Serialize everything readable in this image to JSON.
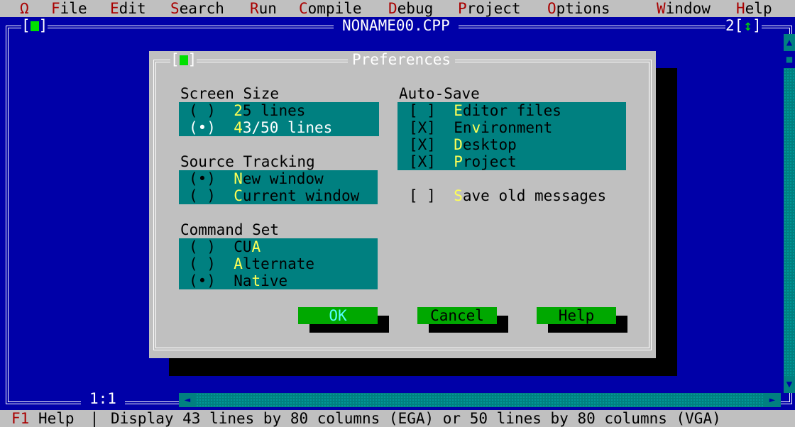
{
  "menu": {
    "system": "Ω",
    "items": [
      {
        "hk": "F",
        "rest": "ile"
      },
      {
        "hk": "E",
        "rest": "dit"
      },
      {
        "hk": "S",
        "rest": "earch"
      },
      {
        "hk": "R",
        "rest": "un"
      },
      {
        "hk": "C",
        "rest": "ompile"
      },
      {
        "hk": "D",
        "rest": "ebug"
      },
      {
        "hk": "P",
        "rest": "roject"
      },
      {
        "hk": "O",
        "rest": "ptions"
      },
      {
        "hk": "W",
        "rest": "indow"
      },
      {
        "hk": "H",
        "rest": "elp"
      }
    ]
  },
  "editor": {
    "title": "NONAME00.CPP",
    "window_number": "2",
    "close_left": "[",
    "close_right": "]",
    "zoom_left": "[",
    "zoom_glyph": "↕",
    "zoom_right": "]",
    "cursor_position": "1:1"
  },
  "dialog": {
    "title": "Preferences",
    "close_left": "[",
    "close_right": "]",
    "screen_size": {
      "label": "Screen Size",
      "options": [
        {
          "pre": "( )  ",
          "hk": "2",
          "post": "5 lines",
          "selected": false
        },
        {
          "pre": "(•)  ",
          "hk": "4",
          "post": "3/50 lines",
          "selected": true
        }
      ]
    },
    "source_tracking": {
      "label": "Source Tracking",
      "options": [
        {
          "pre": "(•)  ",
          "hk": "N",
          "post": "ew window",
          "selected": true
        },
        {
          "pre": "( )  ",
          "hk": "C",
          "post": "urrent window",
          "selected": false
        }
      ]
    },
    "command_set": {
      "label": "Command Set",
      "options": [
        {
          "pre": "( )  ",
          "hk_pre": "CU",
          "hk": "A",
          "post": "",
          "selected": false
        },
        {
          "pre": "( )  ",
          "hk_pre": "",
          "hk": "A",
          "post": "lternate",
          "selected": false
        },
        {
          "pre": "(•)  ",
          "hk_pre": "Na",
          "hk": "t",
          "post": "ive",
          "selected": true
        }
      ]
    },
    "auto_save": {
      "label": "Auto-Save",
      "options": [
        {
          "box": "[ ]  ",
          "hk": "E",
          "post": "ditor files",
          "checked": false
        },
        {
          "box": "[X]  ",
          "hk_pre": "En",
          "hk": "v",
          "post": "ironment",
          "checked": true
        },
        {
          "box": "[X]  ",
          "hk": "D",
          "post": "esktop",
          "checked": true
        },
        {
          "box": "[X]  ",
          "hk": "P",
          "post": "roject",
          "checked": true
        }
      ]
    },
    "save_old_messages": {
      "box": "[ ]  ",
      "hk": "S",
      "post": "ave old messages",
      "checked": false
    },
    "buttons": {
      "ok": "OK",
      "cancel": "Cancel",
      "help": "Help"
    }
  },
  "status": {
    "key": "F1",
    "key_label": " Help",
    "separator": " | ",
    "message": "Display 43 lines by 80 columns (EGA) or 50 lines by 80 columns (VGA)"
  },
  "colors": {
    "desktop": "#0000a8",
    "menu_bg": "#c0c0c0",
    "hotkey_menu": "#a80000",
    "dialog_bg": "#c0c0c0",
    "cluster_bg": "#008080",
    "hotkey_cluster": "#ffff55",
    "button_bg": "#00a800",
    "default_button_text": "#55ffff",
    "icon_green": "#00e000"
  },
  "icons": {
    "system_menu": "omega-icon",
    "close": "close-box-icon",
    "zoom": "zoom-icon"
  }
}
